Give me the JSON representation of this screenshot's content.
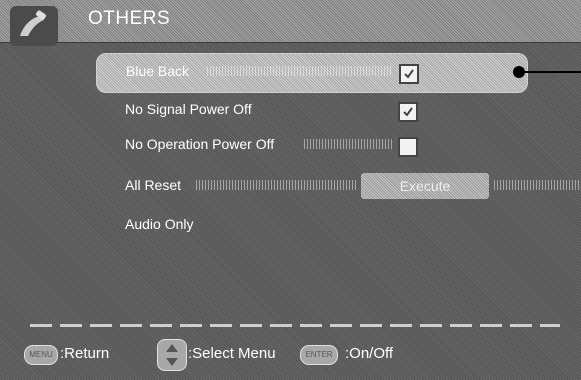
{
  "header": {
    "title": "OTHERS",
    "icon": "wrench-hand-icon"
  },
  "menu": {
    "items": [
      {
        "label": "Blue Back",
        "control": "checkbox",
        "checked": true
      },
      {
        "label": "No Signal Power Off",
        "control": "checkbox",
        "checked": true
      },
      {
        "label": "No Operation Power Off",
        "control": "checkbox",
        "checked": false
      },
      {
        "label": "All Reset",
        "control": "button",
        "button_label": "Execute"
      },
      {
        "label": "Audio Only",
        "control": "none"
      }
    ]
  },
  "footer": {
    "menu_key": "MENU",
    "return_label": ":Return",
    "select_label": ":Select Menu",
    "enter_key": "ENTER",
    "onoff_label": ":On/Off"
  },
  "colors": {
    "background": "#5a5a5a",
    "highlight": "#b9b9b9",
    "text": "#ffffff",
    "callout": "#000000"
  }
}
